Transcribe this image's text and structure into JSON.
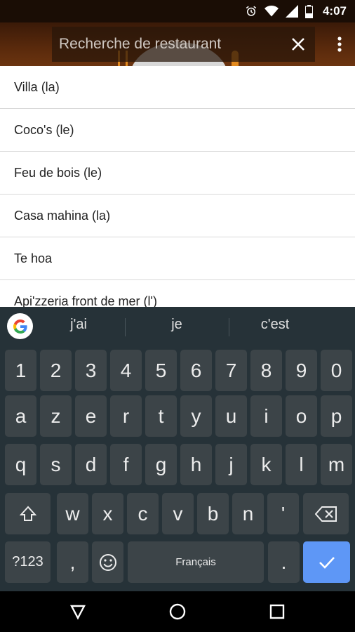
{
  "status_bar": {
    "time": "4:07",
    "icons": [
      "alarm-icon",
      "wifi-icon",
      "signal-icon",
      "battery-icon"
    ]
  },
  "search": {
    "placeholder": "Recherche de restaurant"
  },
  "results": [
    "Villa (la)",
    "Coco's (le)",
    "Feu de bois (le)",
    "Casa mahina (la)",
    "Te hoa",
    "Api'zzeria front de mer (l')"
  ],
  "keyboard": {
    "suggestions": [
      "j'ai",
      "je",
      "c'est"
    ],
    "row_numbers": [
      "1",
      "2",
      "3",
      "4",
      "5",
      "6",
      "7",
      "8",
      "9",
      "0"
    ],
    "row_1": [
      "a",
      "z",
      "e",
      "r",
      "t",
      "y",
      "u",
      "i",
      "o",
      "p"
    ],
    "row_2": [
      "q",
      "s",
      "d",
      "f",
      "g",
      "h",
      "j",
      "k",
      "l",
      "m"
    ],
    "row_3": [
      "w",
      "x",
      "c",
      "v",
      "b",
      "n",
      "'"
    ],
    "symbols_label": "?123",
    "comma_label": ",",
    "space_label": "Français",
    "period_label": "."
  },
  "colors": {
    "enter_key": "#5e97f6",
    "keyboard_bg": "#263238",
    "key_bg": "#3c4448",
    "accent_orange": "#e38a1e"
  }
}
